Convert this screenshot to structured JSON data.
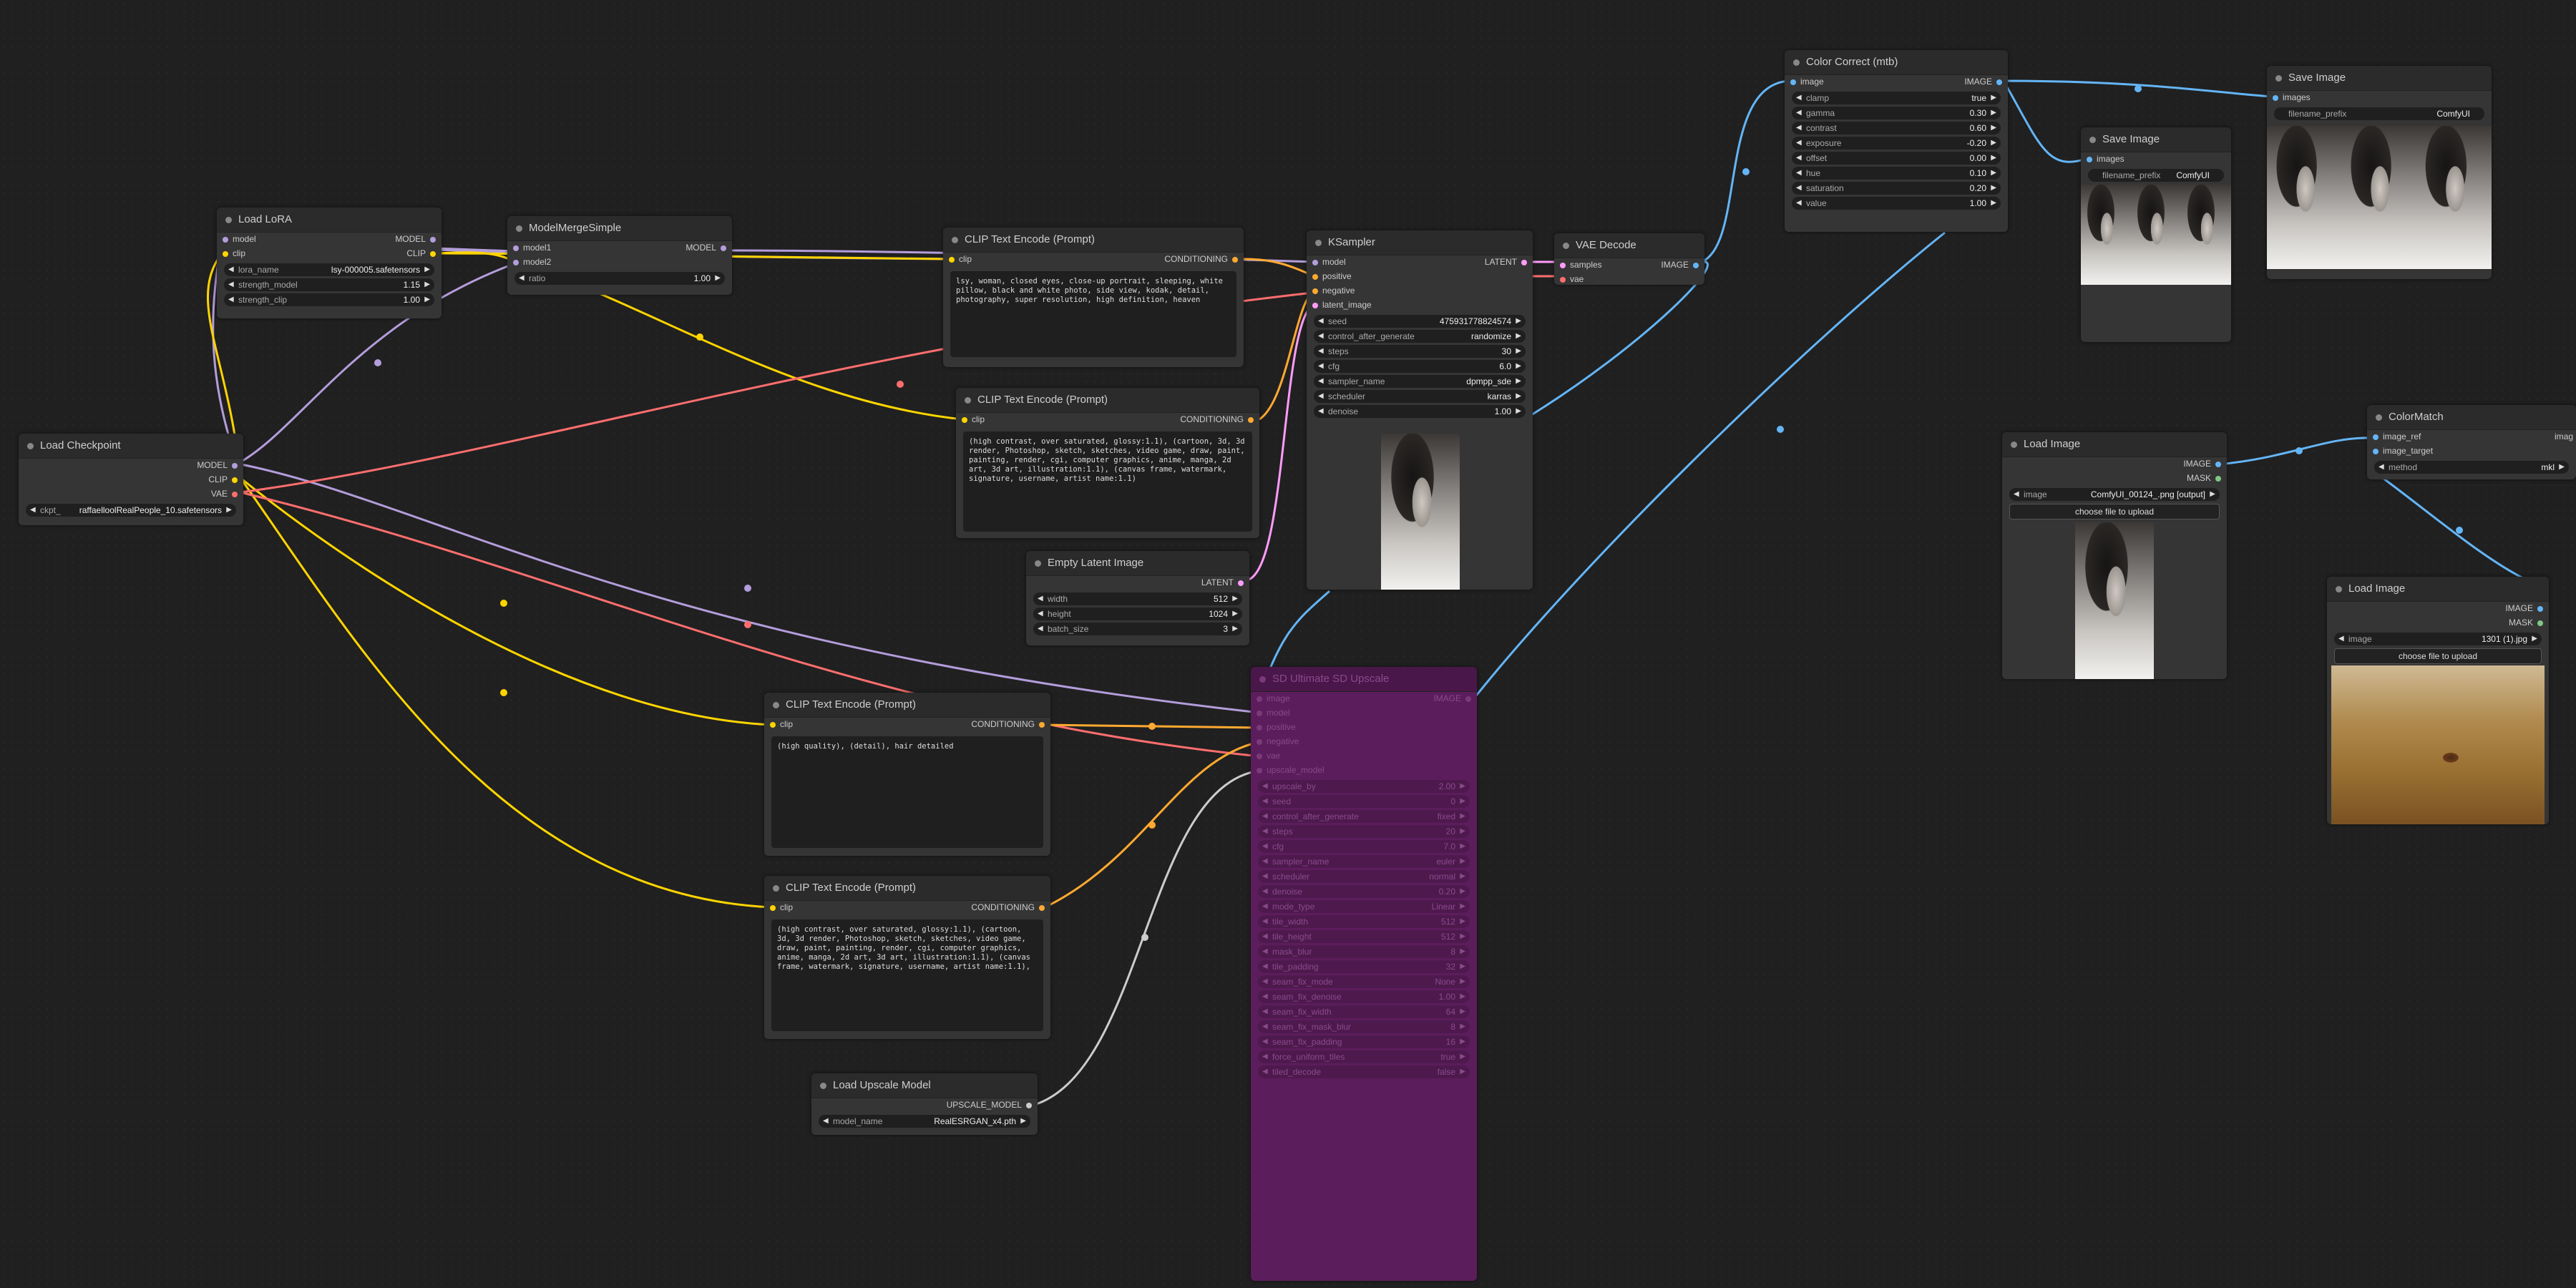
{
  "colors": {
    "model": "#b39ddb",
    "clip": "#ffd500",
    "vae": "#ff6e6e",
    "conditioning": "#ffa931",
    "latent": "#ff9cf9",
    "image": "#64b5f6",
    "mask": "#81c784",
    "upscale_model": "#cccccc",
    "canvas": "#202020",
    "node": "#353535",
    "bypassed": "#5c1d5c"
  },
  "load_lora": {
    "title": "Load LoRA",
    "inputs": [
      "model",
      "clip"
    ],
    "outputs": [
      "MODEL",
      "CLIP"
    ],
    "widgets": [
      {
        "label": "lora_name",
        "value": "lsy-000005.safetensors"
      },
      {
        "label": "strength_model",
        "value": "1.15"
      },
      {
        "label": "strength_clip",
        "value": "1.00"
      }
    ]
  },
  "model_merge": {
    "title": "ModelMergeSimple",
    "inputs": [
      "model1",
      "model2"
    ],
    "outputs": [
      "MODEL"
    ],
    "widgets": [
      {
        "label": "ratio",
        "value": "1.00"
      }
    ]
  },
  "load_checkpoint": {
    "title": "Load Checkpoint",
    "outputs": [
      "MODEL",
      "CLIP",
      "VAE"
    ],
    "widgets": [
      {
        "label": "ckpt_",
        "value": "raffaelloolRealPeople_10.safetensors"
      }
    ]
  },
  "clip_pos": {
    "title": "CLIP Text Encode (Prompt)",
    "input": "clip",
    "output": "CONDITIONING",
    "text": "lsy, woman, closed eyes, close-up portrait, sleeping, white pillow, black and white photo, side view, kodak, detail, photography, super resolution, high definition, heaven"
  },
  "clip_neg": {
    "title": "CLIP Text Encode (Prompt)",
    "input": "clip",
    "output": "CONDITIONING",
    "text": "(high contrast, over saturated, glossy:1.1), (cartoon, 3d, 3d render, Photoshop, sketch, sketches, video game, draw, paint, painting, render, cgi, computer graphics, anime, manga, 2d art, 3d art, illustration:1.1), (canvas frame, watermark, signature, username, artist name:1.1)"
  },
  "empty_latent": {
    "title": "Empty Latent Image",
    "output": "LATENT",
    "widgets": [
      {
        "label": "width",
        "value": "512"
      },
      {
        "label": "height",
        "value": "1024"
      },
      {
        "label": "batch_size",
        "value": "3"
      }
    ]
  },
  "ksampler": {
    "title": "KSampler",
    "inputs": [
      "model",
      "positive",
      "negative",
      "latent_image"
    ],
    "output": "LATENT",
    "widgets": [
      {
        "label": "seed",
        "value": "475931778824574"
      },
      {
        "label": "control_after_generate",
        "value": "randomize"
      },
      {
        "label": "steps",
        "value": "30"
      },
      {
        "label": "cfg",
        "value": "6.0"
      },
      {
        "label": "sampler_name",
        "value": "dpmpp_sde"
      },
      {
        "label": "scheduler",
        "value": "karras"
      },
      {
        "label": "denoise",
        "value": "1.00"
      }
    ]
  },
  "vae_decode": {
    "title": "VAE Decode",
    "inputs": [
      "samples",
      "vae"
    ],
    "output": "IMAGE"
  },
  "color_correct": {
    "title": "Color Correct (mtb)",
    "input": "image",
    "output": "IMAGE",
    "widgets": [
      {
        "label": "clamp",
        "value": "true"
      },
      {
        "label": "gamma",
        "value": "0.30"
      },
      {
        "label": "contrast",
        "value": "0.60"
      },
      {
        "label": "exposure",
        "value": "-0.20"
      },
      {
        "label": "offset",
        "value": "0.00"
      },
      {
        "label": "hue",
        "value": "0.10"
      },
      {
        "label": "saturation",
        "value": "0.20"
      },
      {
        "label": "value",
        "value": "1.00"
      }
    ]
  },
  "save_image_a": {
    "title": "Save Image",
    "input": "images",
    "widgets": [
      {
        "label": "filename_prefix",
        "value": "ComfyUI"
      }
    ]
  },
  "save_image_b": {
    "title": "Save Image",
    "input": "images",
    "widgets": [
      {
        "label": "filename_prefix",
        "value": "ComfyUI"
      }
    ]
  },
  "load_image_a": {
    "title": "Load Image",
    "outputs": [
      "IMAGE",
      "MASK"
    ],
    "widgets": [
      {
        "label": "image",
        "value": "ComfyUI_00124_.png [output]"
      }
    ],
    "upload_label": "choose file to upload"
  },
  "load_image_b": {
    "title": "Load Image",
    "outputs": [
      "IMAGE",
      "MASK"
    ],
    "widgets": [
      {
        "label": "image",
        "value": "1301 (1).jpg"
      }
    ],
    "upload_label": "choose file to upload"
  },
  "color_match": {
    "title": "ColorMatch",
    "inputs": [
      "image_ref",
      "image_target"
    ],
    "output": "imag",
    "widgets": [
      {
        "label": "method",
        "value": "mkl"
      }
    ]
  },
  "clip_detail": {
    "title": "CLIP Text Encode (Prompt)",
    "input": "clip",
    "output": "CONDITIONING",
    "text": "(high quality), (detail), hair detailed"
  },
  "clip_neg2": {
    "title": "CLIP Text Encode (Prompt)",
    "input": "clip",
    "output": "CONDITIONING",
    "text": "(high contrast, over saturated, glossy:1.1), (cartoon, 3d, 3d render, Photoshop, sketch, sketches, video game, draw, paint, painting, render, cgi, computer graphics, anime, manga, 2d art, 3d art, illustration:1.1), (canvas frame, watermark, signature, username, artist name:1.1),"
  },
  "load_upscale": {
    "title": "Load Upscale Model",
    "output": "UPSCALE_MODEL",
    "widgets": [
      {
        "label": "model_name",
        "value": "RealESRGAN_x4.pth"
      }
    ]
  },
  "sd_upscale": {
    "title": "SD Ultimate SD Upscale",
    "inputs": [
      "image",
      "model",
      "positive",
      "negative",
      "vae",
      "upscale_model"
    ],
    "output": "IMAGE",
    "widgets": [
      {
        "label": "upscale_by",
        "value": "2.00"
      },
      {
        "label": "seed",
        "value": "0"
      },
      {
        "label": "control_after_generate",
        "value": "fixed"
      },
      {
        "label": "steps",
        "value": "20"
      },
      {
        "label": "cfg",
        "value": "7.0"
      },
      {
        "label": "sampler_name",
        "value": "euler"
      },
      {
        "label": "scheduler",
        "value": "normal"
      },
      {
        "label": "denoise",
        "value": "0.20"
      },
      {
        "label": "mode_type",
        "value": "Linear"
      },
      {
        "label": "tile_width",
        "value": "512"
      },
      {
        "label": "tile_height",
        "value": "512"
      },
      {
        "label": "mask_blur",
        "value": "8"
      },
      {
        "label": "tile_padding",
        "value": "32"
      },
      {
        "label": "seam_fix_mode",
        "value": "None"
      },
      {
        "label": "seam_fix_denoise",
        "value": "1.00"
      },
      {
        "label": "seam_fix_width",
        "value": "64"
      },
      {
        "label": "seam_fix_mask_blur",
        "value": "8"
      },
      {
        "label": "seam_fix_padding",
        "value": "16"
      },
      {
        "label": "force_uniform_tiles",
        "value": "true"
      },
      {
        "label": "tiled_decode",
        "value": "false"
      }
    ]
  }
}
